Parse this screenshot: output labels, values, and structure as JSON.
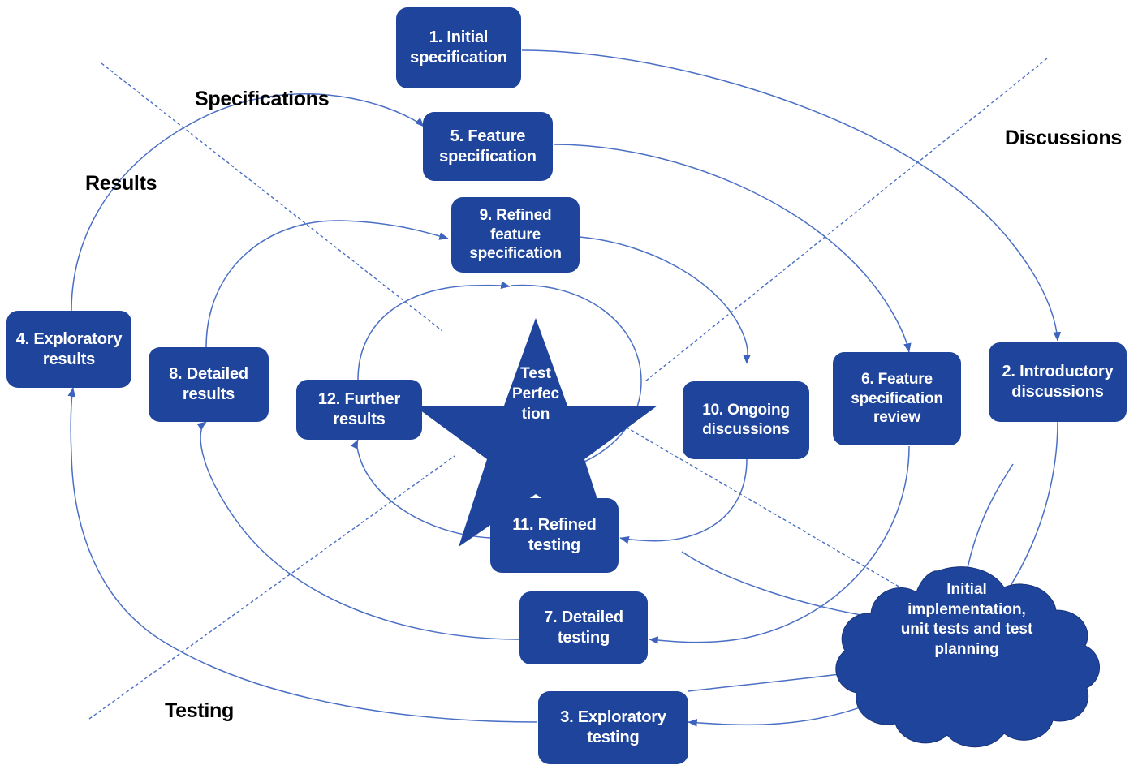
{
  "diagram": {
    "title": "Test Perfection spiral model",
    "colors": {
      "node_fill": "#1F449C",
      "node_text": "#FFFFFF",
      "arc_stroke": "#4A6FC4",
      "quadrant_label": "#000000",
      "background": "#FFFFFF"
    },
    "center": {
      "shape": "star",
      "label": "Test\nPerfec\ntion"
    },
    "cloud": {
      "shape": "cloud",
      "label": "Initial\nimplementation,\nunit tests and test\nplanning"
    },
    "quadrant_labels": [
      {
        "name": "specifications",
        "text": "Specifications"
      },
      {
        "name": "discussions",
        "text": "Discussions"
      },
      {
        "name": "results",
        "text": "Results"
      },
      {
        "name": "testing",
        "text": "Testing"
      }
    ],
    "nodes": [
      {
        "id": "1",
        "text": "1. Initial\nspecification",
        "quadrant": "specifications"
      },
      {
        "id": "5",
        "text": "5. Feature\nspecification",
        "quadrant": "specifications"
      },
      {
        "id": "9",
        "text": "9. Refined\nfeature\nspecification",
        "quadrant": "specifications"
      },
      {
        "id": "2",
        "text": "2. Introductory\ndiscussions",
        "quadrant": "discussions"
      },
      {
        "id": "6",
        "text": "6. Feature\nspecification\nreview",
        "quadrant": "discussions"
      },
      {
        "id": "10",
        "text": "10. Ongoing\ndiscussions",
        "quadrant": "discussions"
      },
      {
        "id": "3",
        "text": "3. Exploratory\ntesting",
        "quadrant": "testing"
      },
      {
        "id": "7",
        "text": "7. Detailed\ntesting",
        "quadrant": "testing"
      },
      {
        "id": "11",
        "text": "11. Refined\ntesting",
        "quadrant": "testing"
      },
      {
        "id": "4",
        "text": "4. Exploratory\nresults",
        "quadrant": "results"
      },
      {
        "id": "8",
        "text": "8. Detailed\nresults",
        "quadrant": "results"
      },
      {
        "id": "12",
        "text": "12. Further\nresults",
        "quadrant": "results"
      }
    ]
  }
}
